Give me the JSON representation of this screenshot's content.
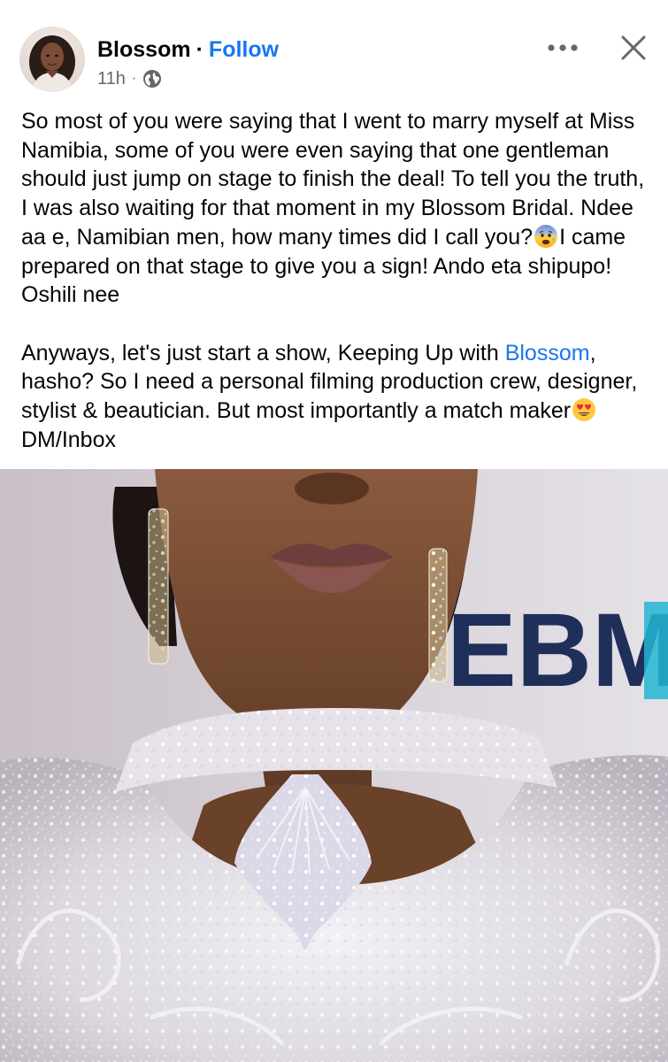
{
  "post": {
    "author": "Blossom",
    "separator": "·",
    "follow_label": "Follow",
    "time": "11h",
    "meta_separator": "·",
    "privacy_icon": "globe-icon",
    "more_icon": "more-horizontal-icon",
    "close_icon": "close-icon",
    "paragraph1": {
      "part1": "So most of you were saying that I went to marry myself at Miss Namibia, some of you were even saying that one gentleman should just jump on stage to finish the deal! To tell you the truth, I was also waiting for that moment in my Blossom Bridal. Ndee aa e, Namibian men, how many times did I call you?",
      "emoji": "anxious-face-emoji",
      "part2": "I came prepared on that stage to give you a sign! Ando eta shipupo! Oshili nee"
    },
    "paragraph2": {
      "part1": "Anyways, let's just start a show, Keeping Up with ",
      "mention": "Blossom",
      "part2": ", hasho? So I need a personal filming production crew, designer, stylist & beautician. But most importantly a match maker",
      "emoji": "heart-eyes-emoji",
      "part3": " DM/Inbox"
    },
    "photo_backdrop_text": "EBMA"
  },
  "colors": {
    "link": "#1877f2",
    "text": "#050505",
    "secondary_text": "#65676b"
  }
}
